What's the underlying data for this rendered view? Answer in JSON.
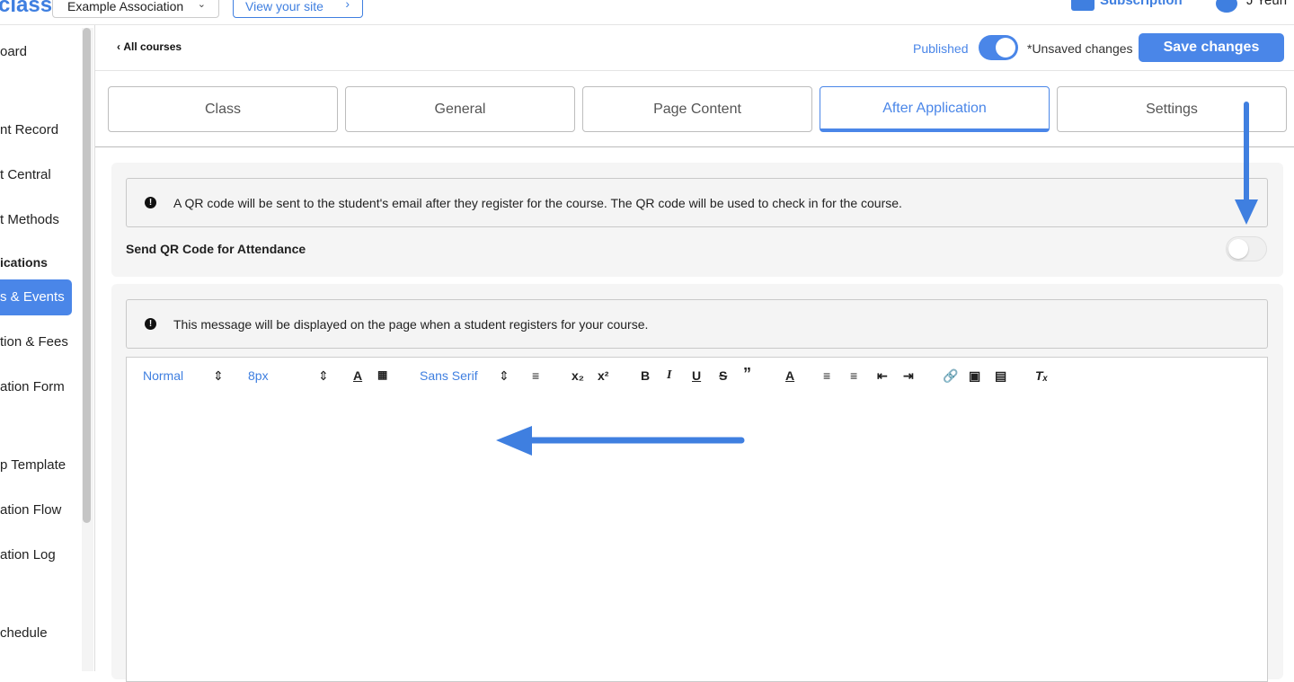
{
  "topbar": {
    "logo": "class",
    "org_select": "Example Association",
    "view_site": "View your site",
    "subscription": "Subscription",
    "user_name": "J Yeun"
  },
  "sidebar": {
    "items": [
      {
        "label": "oard"
      },
      {
        "label": "nt Record"
      },
      {
        "label": "t Central"
      },
      {
        "label": "t Methods"
      },
      {
        "label": "ications"
      },
      {
        "label": "s & Events"
      },
      {
        "label": "tion & Fees"
      },
      {
        "label": "ation Form"
      },
      {
        "label": "p Template"
      },
      {
        "label": "ation Flow"
      },
      {
        "label": "ation Log"
      },
      {
        "label": "chedule"
      }
    ]
  },
  "header": {
    "back_label": "All courses",
    "published_label": "Published",
    "unsaved_label": "*Unsaved changes",
    "save_label": "Save changes"
  },
  "tabs": [
    {
      "label": "Class"
    },
    {
      "label": "General"
    },
    {
      "label": "Page Content"
    },
    {
      "label": "After Application"
    },
    {
      "label": "Settings"
    }
  ],
  "qr_panel": {
    "info_text": "A QR code will be sent to the student's email after they register for the course. The QR code will be used to check in for the course.",
    "toggle_label": "Send QR Code for Attendance"
  },
  "message_panel": {
    "info_text": "This message will be displayed on the page when a student registers for your course."
  },
  "toolbar": {
    "heading_select": "Normal",
    "size_select": "8px",
    "font_select": "Sans Serif"
  },
  "colors": {
    "accent": "#4a86e8",
    "annotation": "#3f7fe0"
  }
}
